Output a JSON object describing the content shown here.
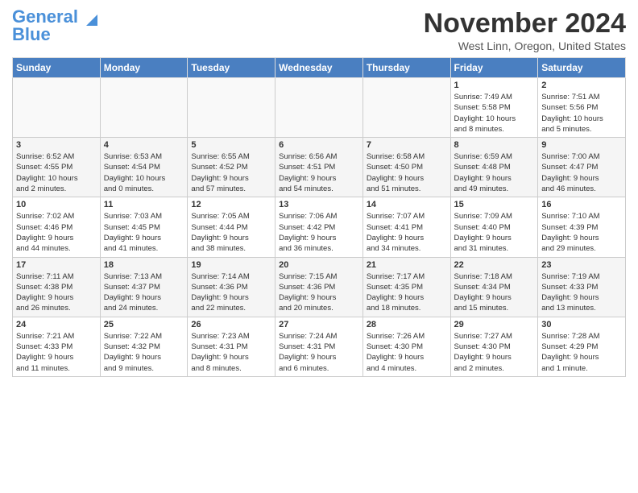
{
  "header": {
    "logo_line1": "General",
    "logo_line2": "Blue",
    "month": "November 2024",
    "location": "West Linn, Oregon, United States"
  },
  "weekdays": [
    "Sunday",
    "Monday",
    "Tuesday",
    "Wednesday",
    "Thursday",
    "Friday",
    "Saturday"
  ],
  "weeks": [
    [
      {
        "day": "",
        "info": ""
      },
      {
        "day": "",
        "info": ""
      },
      {
        "day": "",
        "info": ""
      },
      {
        "day": "",
        "info": ""
      },
      {
        "day": "",
        "info": ""
      },
      {
        "day": "1",
        "info": "Sunrise: 7:49 AM\nSunset: 5:58 PM\nDaylight: 10 hours\nand 8 minutes."
      },
      {
        "day": "2",
        "info": "Sunrise: 7:51 AM\nSunset: 5:56 PM\nDaylight: 10 hours\nand 5 minutes."
      }
    ],
    [
      {
        "day": "3",
        "info": "Sunrise: 6:52 AM\nSunset: 4:55 PM\nDaylight: 10 hours\nand 2 minutes."
      },
      {
        "day": "4",
        "info": "Sunrise: 6:53 AM\nSunset: 4:54 PM\nDaylight: 10 hours\nand 0 minutes."
      },
      {
        "day": "5",
        "info": "Sunrise: 6:55 AM\nSunset: 4:52 PM\nDaylight: 9 hours\nand 57 minutes."
      },
      {
        "day": "6",
        "info": "Sunrise: 6:56 AM\nSunset: 4:51 PM\nDaylight: 9 hours\nand 54 minutes."
      },
      {
        "day": "7",
        "info": "Sunrise: 6:58 AM\nSunset: 4:50 PM\nDaylight: 9 hours\nand 51 minutes."
      },
      {
        "day": "8",
        "info": "Sunrise: 6:59 AM\nSunset: 4:48 PM\nDaylight: 9 hours\nand 49 minutes."
      },
      {
        "day": "9",
        "info": "Sunrise: 7:00 AM\nSunset: 4:47 PM\nDaylight: 9 hours\nand 46 minutes."
      }
    ],
    [
      {
        "day": "10",
        "info": "Sunrise: 7:02 AM\nSunset: 4:46 PM\nDaylight: 9 hours\nand 44 minutes."
      },
      {
        "day": "11",
        "info": "Sunrise: 7:03 AM\nSunset: 4:45 PM\nDaylight: 9 hours\nand 41 minutes."
      },
      {
        "day": "12",
        "info": "Sunrise: 7:05 AM\nSunset: 4:44 PM\nDaylight: 9 hours\nand 38 minutes."
      },
      {
        "day": "13",
        "info": "Sunrise: 7:06 AM\nSunset: 4:42 PM\nDaylight: 9 hours\nand 36 minutes."
      },
      {
        "day": "14",
        "info": "Sunrise: 7:07 AM\nSunset: 4:41 PM\nDaylight: 9 hours\nand 34 minutes."
      },
      {
        "day": "15",
        "info": "Sunrise: 7:09 AM\nSunset: 4:40 PM\nDaylight: 9 hours\nand 31 minutes."
      },
      {
        "day": "16",
        "info": "Sunrise: 7:10 AM\nSunset: 4:39 PM\nDaylight: 9 hours\nand 29 minutes."
      }
    ],
    [
      {
        "day": "17",
        "info": "Sunrise: 7:11 AM\nSunset: 4:38 PM\nDaylight: 9 hours\nand 26 minutes."
      },
      {
        "day": "18",
        "info": "Sunrise: 7:13 AM\nSunset: 4:37 PM\nDaylight: 9 hours\nand 24 minutes."
      },
      {
        "day": "19",
        "info": "Sunrise: 7:14 AM\nSunset: 4:36 PM\nDaylight: 9 hours\nand 22 minutes."
      },
      {
        "day": "20",
        "info": "Sunrise: 7:15 AM\nSunset: 4:36 PM\nDaylight: 9 hours\nand 20 minutes."
      },
      {
        "day": "21",
        "info": "Sunrise: 7:17 AM\nSunset: 4:35 PM\nDaylight: 9 hours\nand 18 minutes."
      },
      {
        "day": "22",
        "info": "Sunrise: 7:18 AM\nSunset: 4:34 PM\nDaylight: 9 hours\nand 15 minutes."
      },
      {
        "day": "23",
        "info": "Sunrise: 7:19 AM\nSunset: 4:33 PM\nDaylight: 9 hours\nand 13 minutes."
      }
    ],
    [
      {
        "day": "24",
        "info": "Sunrise: 7:21 AM\nSunset: 4:33 PM\nDaylight: 9 hours\nand 11 minutes."
      },
      {
        "day": "25",
        "info": "Sunrise: 7:22 AM\nSunset: 4:32 PM\nDaylight: 9 hours\nand 9 minutes."
      },
      {
        "day": "26",
        "info": "Sunrise: 7:23 AM\nSunset: 4:31 PM\nDaylight: 9 hours\nand 8 minutes."
      },
      {
        "day": "27",
        "info": "Sunrise: 7:24 AM\nSunset: 4:31 PM\nDaylight: 9 hours\nand 6 minutes."
      },
      {
        "day": "28",
        "info": "Sunrise: 7:26 AM\nSunset: 4:30 PM\nDaylight: 9 hours\nand 4 minutes."
      },
      {
        "day": "29",
        "info": "Sunrise: 7:27 AM\nSunset: 4:30 PM\nDaylight: 9 hours\nand 2 minutes."
      },
      {
        "day": "30",
        "info": "Sunrise: 7:28 AM\nSunset: 4:29 PM\nDaylight: 9 hours\nand 1 minute."
      }
    ]
  ]
}
